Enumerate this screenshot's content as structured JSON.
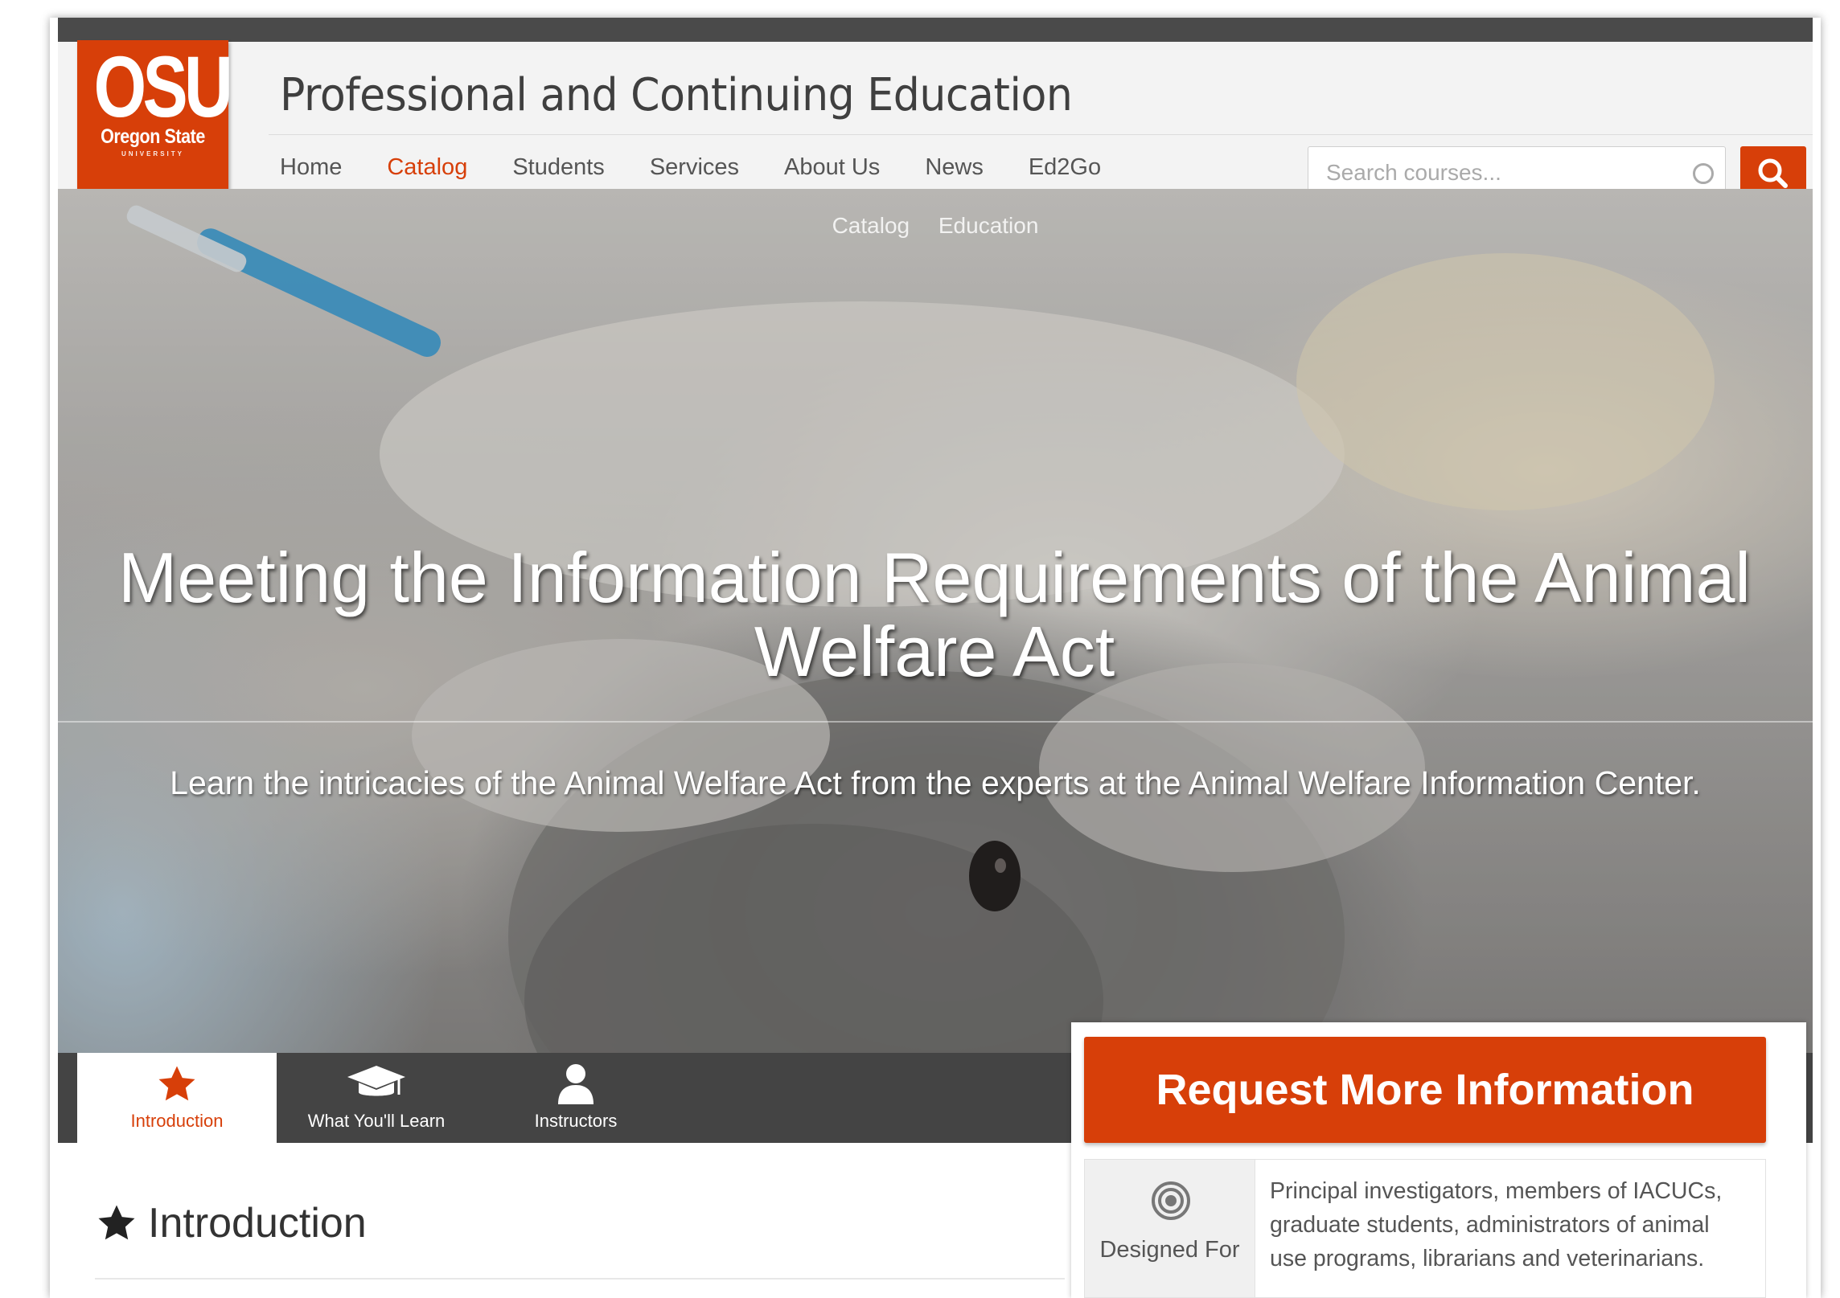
{
  "logo": {
    "mark": "OSU",
    "name": "Oregon State",
    "sub": "UNIVERSITY"
  },
  "header": {
    "site_title": "Professional and Continuing Education",
    "nav": [
      "Home",
      "Catalog",
      "Students",
      "Services",
      "About Us",
      "News",
      "Ed2Go"
    ],
    "active_nav": "Catalog",
    "color_bar": [
      "#d73f09",
      "#aa9d2e",
      "#4a773c",
      "#ffb500",
      "#c6dae7",
      "#3d1152"
    ]
  },
  "search": {
    "placeholder": "Search courses...",
    "value": "",
    "button_icon": "search-icon",
    "clear_icon": "circle-icon"
  },
  "hero": {
    "breadcrumb": [
      "Catalog",
      "Education"
    ],
    "title": "Meeting the Information Requirements of the Animal Welfare Act",
    "subtitle": "Learn the intricacies of the Animal Welfare Act from the experts at the Animal Welfare Information Center."
  },
  "tabs": [
    {
      "label": "Introduction",
      "icon": "star-icon",
      "active": true
    },
    {
      "label": "What You'll Learn",
      "icon": "graduation-cap-icon",
      "active": false
    },
    {
      "label": "Instructors",
      "icon": "user-icon",
      "active": false
    }
  ],
  "request": {
    "label": "Request More Information"
  },
  "designed_for": {
    "label": "Designed For",
    "icon": "target-icon",
    "text": "Principal investigators, members of IACUCs, graduate students, administrators of animal use programs, librarians and veterinarians."
  },
  "intro": {
    "heading": "Introduction",
    "icon": "star-icon"
  },
  "colors": {
    "brand": "#d73f09",
    "dark_bar": "#444444",
    "text": "#555555"
  }
}
